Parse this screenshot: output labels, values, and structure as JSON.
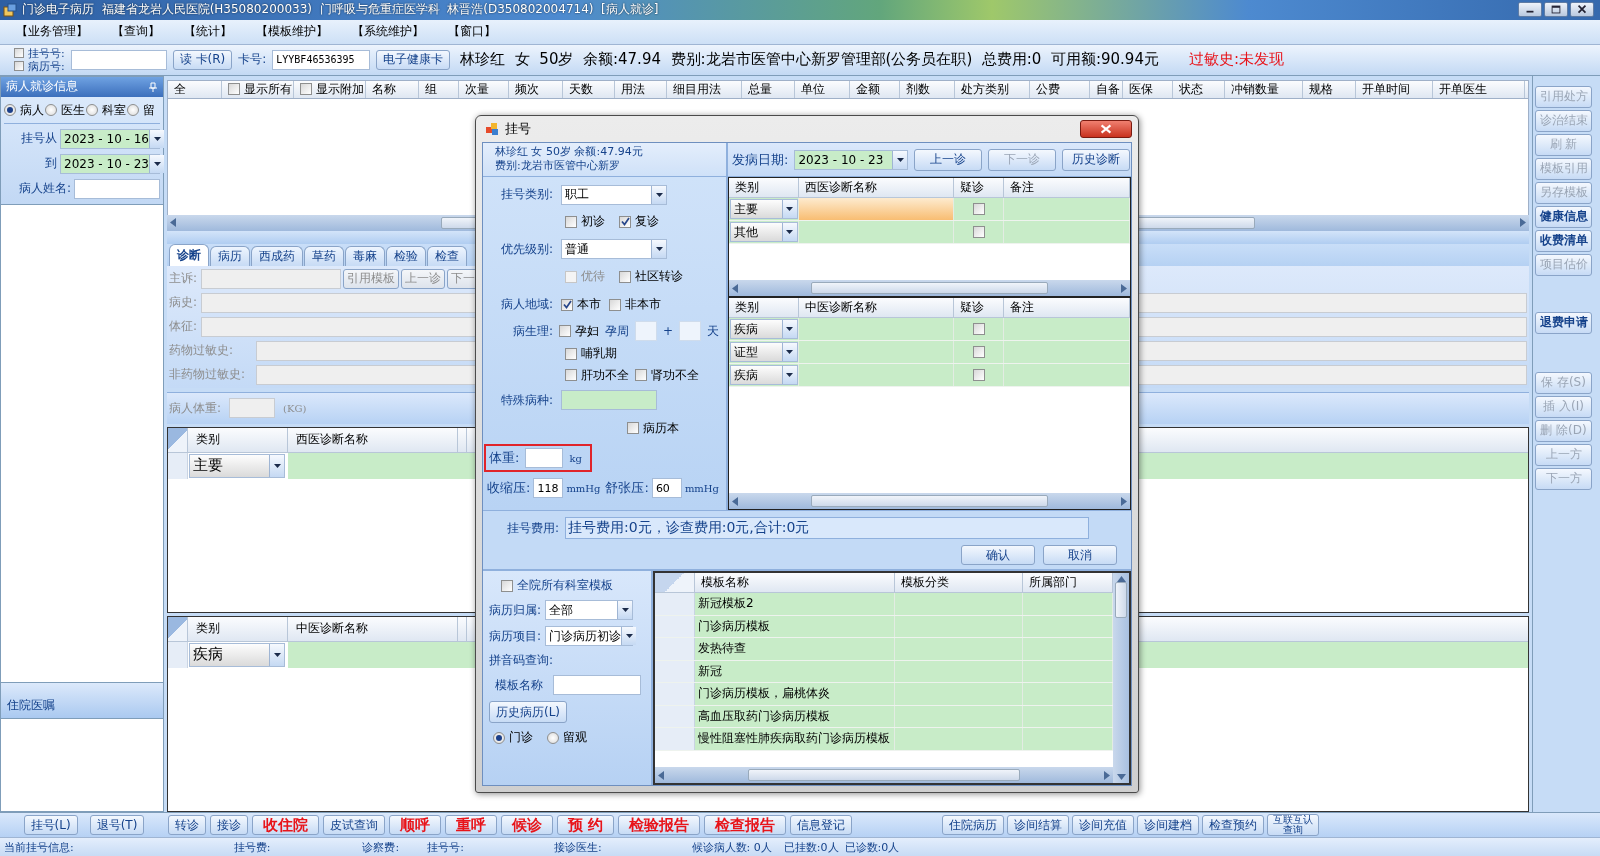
{
  "window": {
    "title": "门诊电子病历  福建省龙岩人民医院(H35080200033)  门呼吸与危重症医学科  林晋浩(D350802004714)  [病人就诊]"
  },
  "menu": [
    "【业务管理】",
    "【查询】",
    "【统计】",
    "【模板维护】",
    "【系统维护】",
    "【窗口】"
  ],
  "patient_bar": {
    "id_checks": [
      {
        "label": "挂号号:",
        "checked": false
      },
      {
        "label": "病历号:",
        "checked": false
      }
    ],
    "read_card_button": "读 卡(R)",
    "card_label": "卡号:",
    "card_number": "LYYBF46536395",
    "health_card_button": "电子健康卡",
    "summary": "林珍红  女  50岁  余额:47.94  费别:龙岩市医管中心新罗管理部(公务员在职)  总费用:0  可用额:90.94元",
    "allergy": "过敏史:未发现"
  },
  "left_panel": {
    "title": "病人就诊信息",
    "filters": [
      {
        "label": "病人",
        "selected": true
      },
      {
        "label": "医生",
        "selected": false
      },
      {
        "label": "科室",
        "selected": false
      },
      {
        "label": "留",
        "selected": false
      }
    ],
    "date_from": {
      "label": "挂号从",
      "value": "2023 - 10 - 16"
    },
    "date_to": {
      "label": "到",
      "value": "2023 - 10 - 23"
    },
    "name_label": "病人姓名:",
    "orders_title": "住院医嘱",
    "buttons": [
      "挂号(L)",
      "退号(T)"
    ]
  },
  "orders": {
    "select_all": "全",
    "options": [
      {
        "label": "显示所有",
        "checked": false
      },
      {
        "label": "显示附加",
        "checked": false
      }
    ],
    "columns": [
      "名称",
      "组",
      "次量",
      "频次",
      "天数",
      "用法",
      "细目用法",
      "总量",
      "单位",
      "金额",
      "剂数",
      "处方类别",
      "公费",
      "自备",
      "医保",
      "状态",
      "冲销数量",
      "规格",
      "开单时间",
      "开单医生"
    ]
  },
  "tabs": [
    {
      "label": "诊断",
      "selected": true
    },
    {
      "label": "病历",
      "selected": false
    },
    {
      "label": "西成药",
      "selected": false
    },
    {
      "label": "草药",
      "selected": false
    },
    {
      "label": "毒麻",
      "selected": false
    },
    {
      "label": "检验",
      "selected": false
    },
    {
      "label": "检查",
      "selected": false
    }
  ],
  "diagnosis_form": {
    "fields": [
      "主诉:",
      "病史:",
      "体征:",
      "药物过敏史:",
      "非药物过敏史:"
    ],
    "buttons": [
      "引用模板",
      "上一诊",
      "下一"
    ],
    "weight_label": "病人体重:",
    "weight_unit": "(KG)"
  },
  "western_diagnosis": {
    "columns": [
      "类别",
      "西医诊断名称"
    ],
    "rows": [
      {
        "category": "主要"
      }
    ]
  },
  "tcm_diagnosis": {
    "columns": [
      "类别",
      "中医诊断名称"
    ],
    "rows": [
      {
        "category": "疾病"
      }
    ]
  },
  "side_button_groups": [
    [
      {
        "label": "引用处方",
        "disabled": true
      },
      {
        "label": "诊治结束",
        "disabled": true
      },
      {
        "label": "刷 新",
        "disabled": true
      },
      {
        "label": "模板引用",
        "disabled": true
      },
      {
        "label": "另存模板",
        "disabled": true
      },
      {
        "label": "健康信息",
        "disabled": false
      },
      {
        "label": "收费清单",
        "disabled": false
      },
      {
        "label": "项目估价",
        "disabled": true
      }
    ],
    [
      {
        "label": "退费申请",
        "disabled": false
      }
    ],
    [
      {
        "label": "保 存(S)",
        "disabled": true
      },
      {
        "label": "插 入(I)",
        "disabled": true
      },
      {
        "label": "删 除(D)",
        "disabled": true
      },
      {
        "label": "上一方",
        "disabled": true
      },
      {
        "label": "下一方",
        "disabled": true
      }
    ]
  ],
  "action_buttons": [
    {
      "label": "转诊",
      "highlight": false
    },
    {
      "label": "接诊",
      "highlight": false
    },
    {
      "label": "收住院",
      "highlight": true
    },
    {
      "label": "皮试查询",
      "highlight": false
    },
    {
      "label": "顺呼",
      "highlight": true
    },
    {
      "label": "重呼",
      "highlight": true
    },
    {
      "label": "候诊",
      "highlight": true
    },
    {
      "label": "预 约",
      "highlight": true
    },
    {
      "label": "检验报告",
      "highlight": true
    },
    {
      "label": "检查报告",
      "highlight": true
    },
    {
      "label": "信息登记",
      "highlight": false
    }
  ],
  "service_buttons": [
    "住院病历",
    "诊间结算",
    "诊间充值",
    "诊间建档",
    "检查预约",
    "互联互认查询"
  ],
  "status_bar": [
    "当前挂号信息:",
    "挂号费:",
    "诊察费:",
    "挂号号:",
    "接诊医生:",
    "候诊病人数: 0人",
    "已挂数:0人",
    "已诊数:0人"
  ],
  "dialog": {
    "title": "挂号",
    "patient_line": "林珍红 女 50岁 余额:47.94元",
    "fee_type_line": "费别:龙岩市医管中心新罗",
    "onset_label": "发病日期:",
    "onset_date": "2023 - 10 - 23",
    "nav_buttons": [
      {
        "label": "上一诊",
        "disabled": false
      },
      {
        "label": "下一诊",
        "disabled": true
      },
      {
        "label": "历史诊断",
        "disabled": false
      }
    ],
    "reg_type": {
      "label": "挂号类别:",
      "value": "职工"
    },
    "visit_checks": [
      {
        "label": "初诊",
        "checked": false,
        "disabled": false
      },
      {
        "label": "复诊",
        "checked": true,
        "disabled": false
      }
    ],
    "priority": {
      "label": "优先级别:",
      "value": "普通"
    },
    "priority_checks": [
      {
        "label": "优待",
        "checked": false,
        "disabled": true
      },
      {
        "label": "社区转诊",
        "checked": false,
        "disabled": false
      }
    ],
    "region": {
      "label": "病人地域:",
      "options": [
        {
          "label": "本市",
          "checked": true
        },
        {
          "label": "非本市",
          "checked": false
        }
      ]
    },
    "physiology": {
      "label": "病生理:",
      "pregnant": {
        "label": "孕妇",
        "checked": false
      },
      "week_label": "孕周",
      "plus": "+",
      "day_label": "天",
      "lactation": {
        "label": "哺乳期",
        "checked": false
      },
      "organ_checks": [
        {
          "label": "肝功不全",
          "checked": false
        },
        {
          "label": "肾功不全",
          "checked": false
        }
      ]
    },
    "special_disease_label": "特殊病种:",
    "record_book": {
      "label": "病历本",
      "checked": false
    },
    "weight": {
      "label": "体重:",
      "unit": "kg"
    },
    "systolic": {
      "label": "收缩压:",
      "value": "118",
      "unit": "mmHg"
    },
    "diastolic": {
      "label": "舒张压:",
      "value": "60",
      "unit": "mmHg"
    },
    "western": {
      "columns": [
        "类别",
        "西医诊断名称",
        "疑诊",
        "备注"
      ],
      "rows": [
        {
          "category": "主要",
          "suspected": false,
          "selected": true
        },
        {
          "category": "其他",
          "suspected": false,
          "selected": false
        }
      ]
    },
    "tcm": {
      "columns": [
        "类别",
        "中医诊断名称",
        "疑诊",
        "备注"
      ],
      "rows": [
        {
          "category": "疾病",
          "suspected": false
        },
        {
          "category": "证型",
          "suspected": false
        },
        {
          "category": "疾病",
          "suspected": false
        }
      ]
    },
    "fee_label": "挂号费用:",
    "fee_value": "挂号费用:0元，诊查费用:0元,合计:0元",
    "confirm_button": "确认",
    "cancel_button": "取消",
    "all_templates": {
      "label": "全院所有科室模板",
      "checked": false
    },
    "record_owner": {
      "label": "病历归属:",
      "value": "全部"
    },
    "record_item": {
      "label": "病历项目:",
      "value": "门诊病历初诊"
    },
    "pinyin_label": "拼音码查询:",
    "template_name_label": "模板名称",
    "history_button": "历史病历(L)",
    "visit_types": [
      {
        "label": "门诊",
        "selected": true
      },
      {
        "label": "留观",
        "selected": false
      }
    ],
    "templates": {
      "columns": [
        "模板名称",
        "模板分类",
        "所属部门"
      ],
      "rows": [
        {
          "name": "新冠模板2"
        },
        {
          "name": "门诊病历模板"
        },
        {
          "name": "发热待查"
        },
        {
          "name": "新冠"
        },
        {
          "name": "门诊病历模板，扁桃体炎"
        },
        {
          "name": "高血压取药门诊病历模板"
        },
        {
          "name": "慢性阻塞性肺疾病取药门诊病历模板"
        }
      ]
    }
  }
}
